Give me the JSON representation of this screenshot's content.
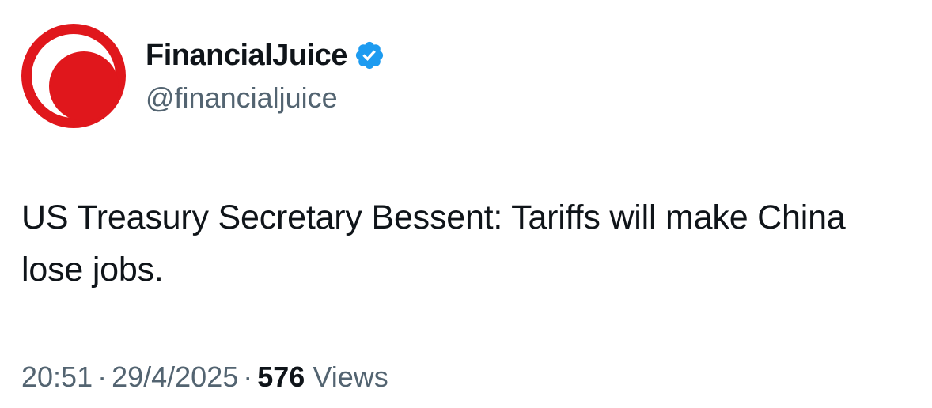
{
  "author": {
    "display_name": "FinancialJuice",
    "handle": "@financialjuice",
    "verified": true,
    "verified_icon": "verified-badge-icon",
    "avatar_colors": {
      "primary": "#e0171c",
      "ring": "#ffffff"
    }
  },
  "tweet": {
    "text": "US Treasury Secretary Bessent: Tariffs will make China lose jobs."
  },
  "meta": {
    "time": "20:51",
    "separator": "·",
    "date": "29/4/2025",
    "views_count": "576",
    "views_label": "Views"
  },
  "colors": {
    "text_primary": "#0f1419",
    "text_secondary": "#536471",
    "verified_blue": "#1d9bf0"
  }
}
